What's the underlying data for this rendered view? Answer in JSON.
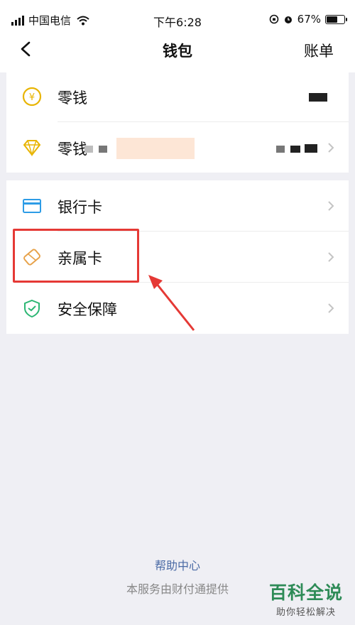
{
  "statusbar": {
    "carrier": "中国电信",
    "time": "下午6:28",
    "battery_percent": "67%",
    "battery_level": 0.67
  },
  "navbar": {
    "title": "钱包",
    "bill_label": "账单"
  },
  "group1": [
    {
      "label": "零钱",
      "icon": "coin-yen-icon",
      "value": ""
    },
    {
      "label": "零钱",
      "icon": "diamond-icon",
      "value": ""
    }
  ],
  "group2": [
    {
      "label": "银行卡",
      "icon": "bank-card-icon"
    },
    {
      "label": "亲属卡",
      "icon": "family-card-icon"
    },
    {
      "label": "安全保障",
      "icon": "shield-icon"
    }
  ],
  "footer": {
    "help": "帮助中心",
    "note": "本服务由财付通提供"
  },
  "watermark": {
    "main": "百科全说",
    "sub": "助你轻松解决"
  },
  "colors": {
    "highlight": "#e53935",
    "link": "#4a6aa5",
    "coin": "#e8b400",
    "bank": "#2d9ce6",
    "family": "#e7a24a",
    "shield": "#2bb673"
  }
}
